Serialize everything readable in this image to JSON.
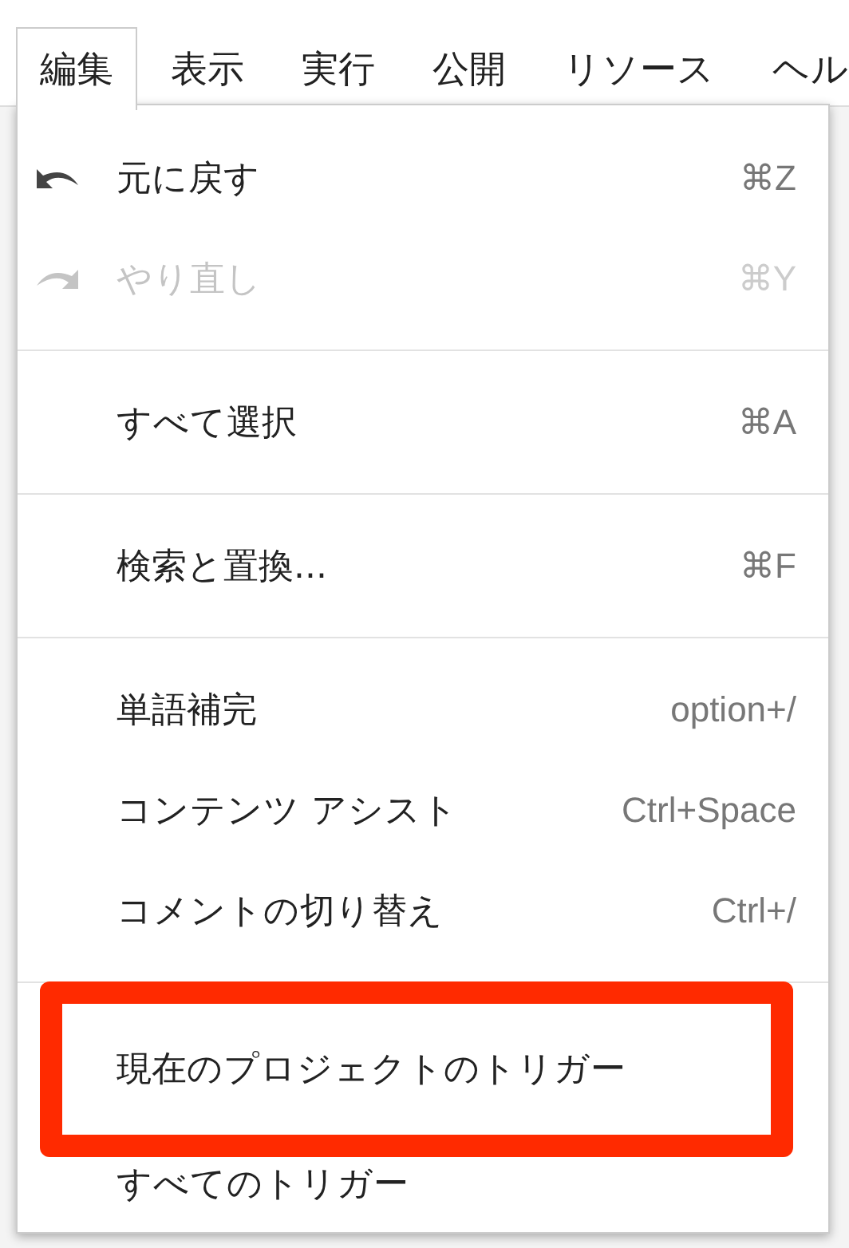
{
  "menubar": [
    {
      "label": "編集",
      "selected": true
    },
    {
      "label": "表示",
      "selected": false
    },
    {
      "label": "実行",
      "selected": false
    },
    {
      "label": "公開",
      "selected": false
    },
    {
      "label": "リソース",
      "selected": false
    },
    {
      "label": "ヘル",
      "selected": false
    }
  ],
  "menu": [
    {
      "kind": "undo",
      "label": "元に戻す",
      "shortcut": "⌘Z",
      "disabled": false,
      "highlighted": false
    },
    {
      "kind": "redo",
      "label": "やり直し",
      "shortcut": "⌘Y",
      "disabled": true,
      "highlighted": false
    },
    {
      "kind": "separator"
    },
    {
      "kind": "item",
      "label": "すべて選択",
      "shortcut": "⌘A",
      "disabled": false,
      "highlighted": false
    },
    {
      "kind": "separator"
    },
    {
      "kind": "item",
      "label": "検索と置換...",
      "shortcut": "⌘F",
      "disabled": false,
      "highlighted": false
    },
    {
      "kind": "separator"
    },
    {
      "kind": "item",
      "label": "単語補完",
      "shortcut": "option+/",
      "disabled": false,
      "highlighted": false
    },
    {
      "kind": "item",
      "label": "コンテンツ アシスト",
      "shortcut": "Ctrl+Space",
      "disabled": false,
      "highlighted": false
    },
    {
      "kind": "item",
      "label": "コメントの切り替え",
      "shortcut": "Ctrl+/",
      "disabled": false,
      "highlighted": false
    },
    {
      "kind": "separator"
    },
    {
      "kind": "item",
      "label": "現在のプロジェクトのトリガー",
      "disabled": false,
      "highlighted": true
    },
    {
      "kind": "item",
      "label": "すべてのトリガー",
      "disabled": false,
      "highlighted": false
    }
  ]
}
